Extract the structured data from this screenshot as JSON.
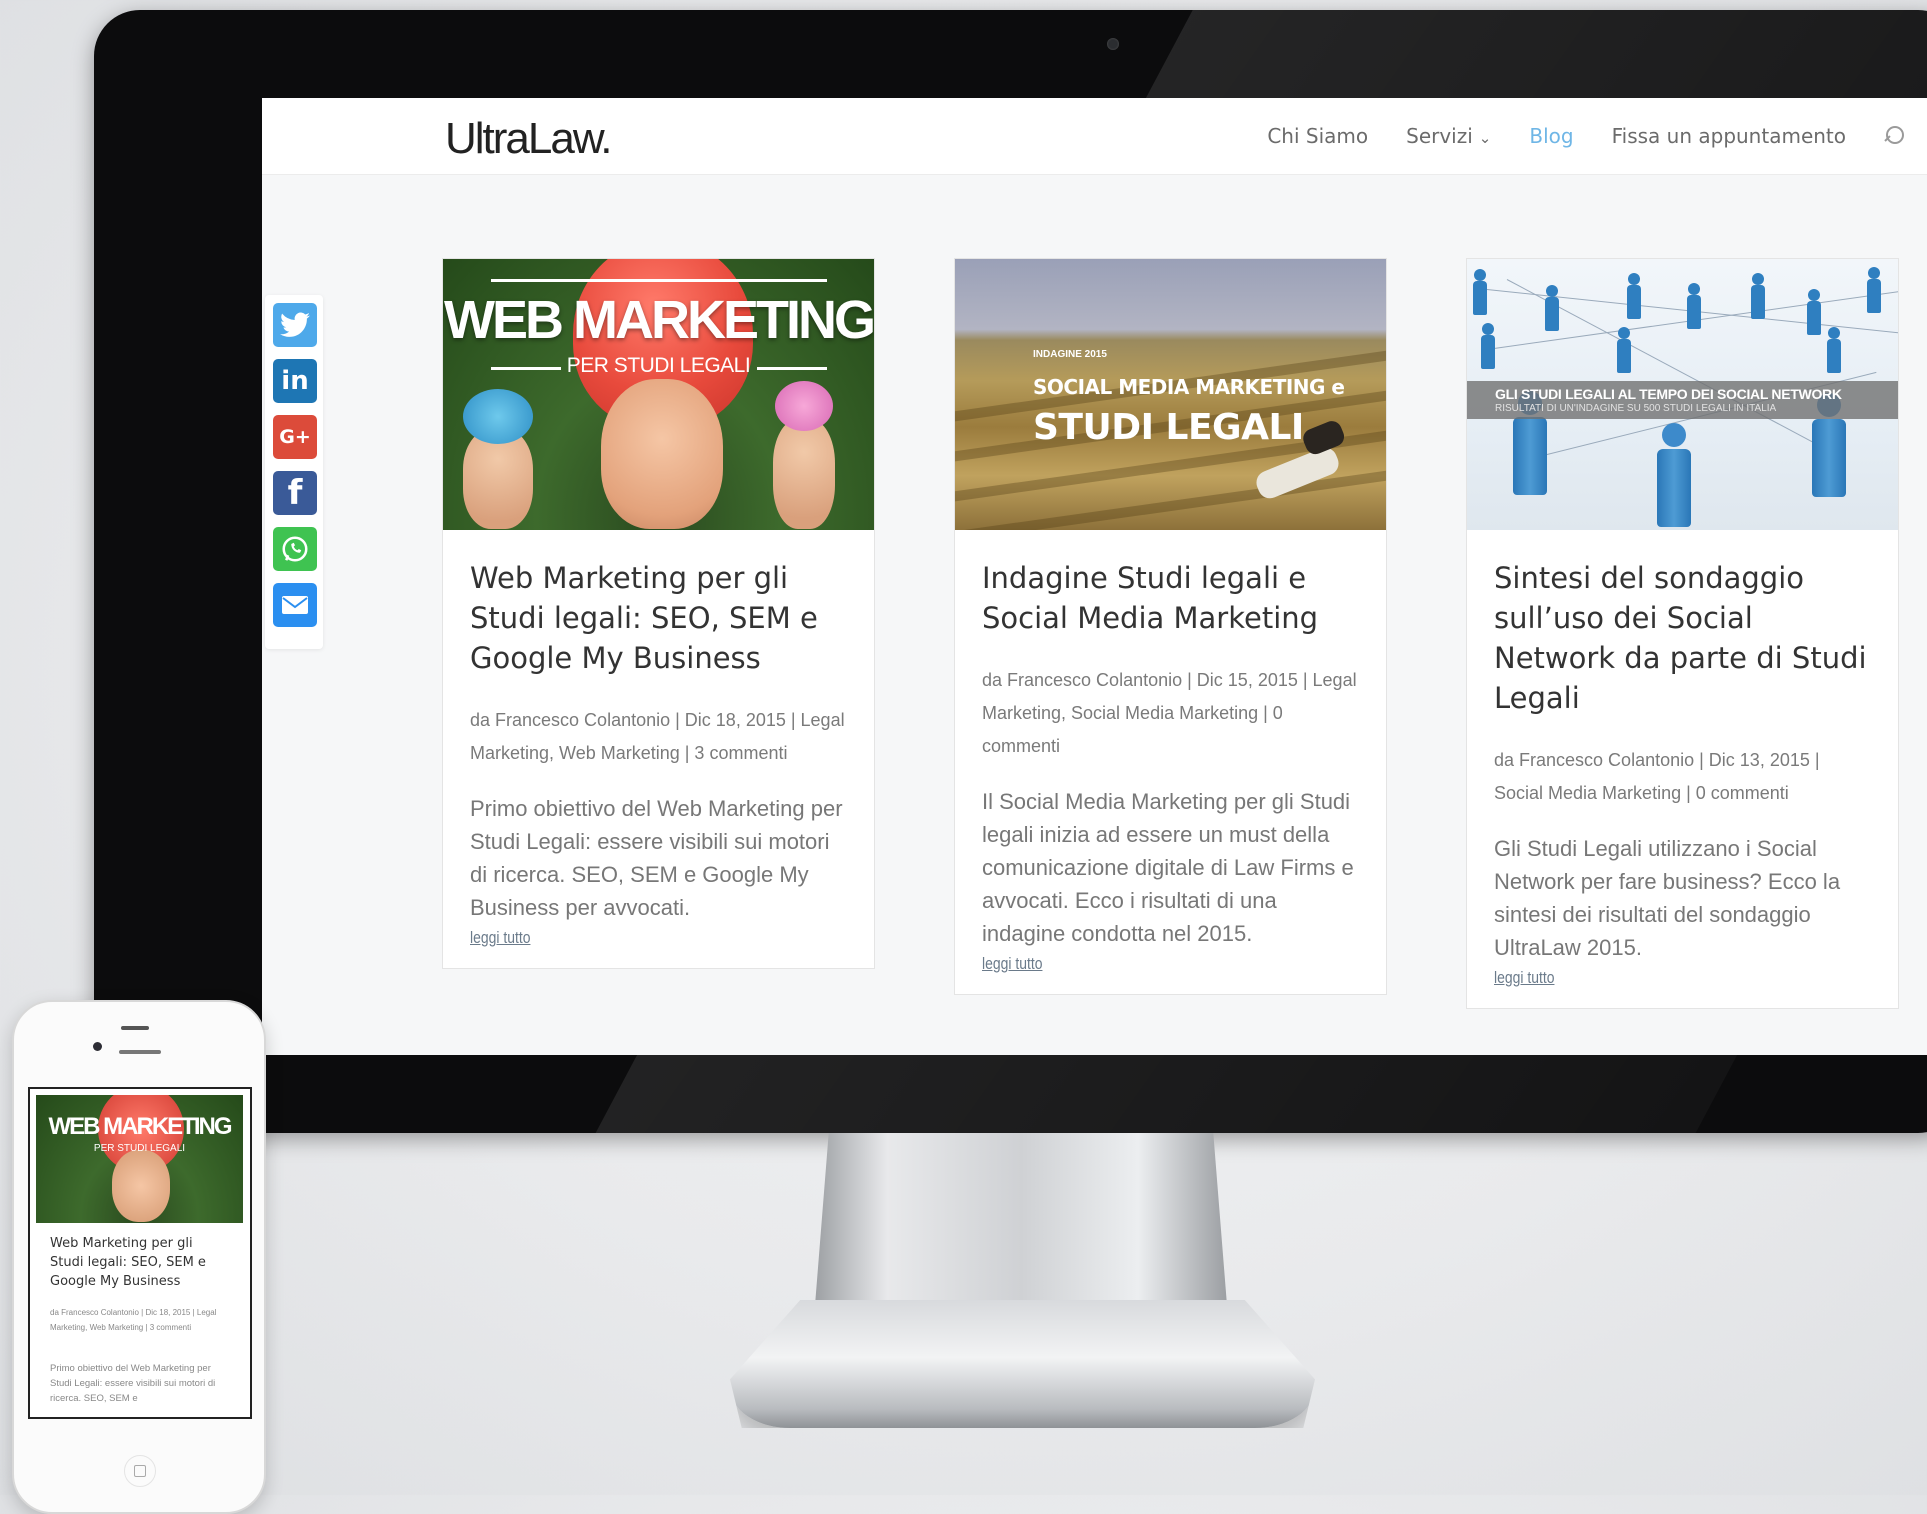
{
  "site": {
    "logo": "UltraLaw."
  },
  "nav": {
    "items": [
      {
        "label": "Chi Siamo"
      },
      {
        "label": "Servizi"
      },
      {
        "label": "Blog"
      },
      {
        "label": "Fissa un appuntamento"
      }
    ],
    "active": "Blog"
  },
  "share": {
    "twitter": "twitter-icon",
    "linkedin_label": "in",
    "googleplus_label": "G+",
    "facebook_label": "f",
    "whatsapp": "whatsapp-icon",
    "email": "email-icon"
  },
  "posts": [
    {
      "image_title": "WEB MARKETING",
      "image_subtitle": "PER STUDI LEGALI",
      "title": "Web Marketing per gli Studi legali: SEO, SEM e Google My Business",
      "meta": "da Francesco Colantonio | Dic 18, 2015 | Legal Marketing, Web Marketing | 3 commenti",
      "excerpt": "Primo obiettivo del Web Marketing per Studi Legali: essere visibili sui motori di ricerca. SEO, SEM e Google My Business per avvocati.",
      "more": "leggi tutto"
    },
    {
      "image_small": "INDAGINE 2015",
      "image_line1": "SOCIAL MEDIA MARKETING e",
      "image_line2": "STUDI LEGALI",
      "title": "Indagine Studi legali e Social Media Marketing",
      "meta": "da Francesco Colantonio | Dic 15, 2015 | Legal Marketing, Social Media Marketing | 0 commenti",
      "excerpt": "Il Social Media Marketing per gli Studi legali inizia ad essere un must della comunicazione digitale di Law Firms e avvocati. Ecco i risultati di una indagine condotta nel 2015.",
      "more": "leggi tutto"
    },
    {
      "image_line1": "GLI STUDI LEGALI AL TEMPO DEI SOCIAL NETWORK",
      "image_line2": "RISULTATI DI UN'INDAGINE SU 500 STUDI LEGALI IN ITALIA",
      "title": "Sintesi del sondaggio sull’uso dei Social Network da parte di Studi Legali",
      "meta": "da Francesco Colantonio | Dic 13, 2015 | Social Media Marketing | 0 commenti",
      "excerpt": "Gli Studi Legali utilizzano i Social Network per fare business? Ecco la sintesi dei risultati del sondaggio UltraLaw 2015.",
      "more": "leggi tutto"
    }
  ],
  "phone": {
    "image_title": "WEB MARKETING",
    "image_subtitle": "PER STUDI LEGALI",
    "title": "Web Marketing per gli Studi legali: SEO, SEM e Google My Business",
    "meta": "da Francesco Colantonio | Dic 18, 2015 | Legal Marketing, Web Marketing | 3 commenti",
    "excerpt": "Primo obiettivo del Web Marketing per Studi Legali: essere visibili sui motori di ricerca. SEO, SEM e"
  },
  "colors": {
    "accent": "#6fb6e6",
    "twitter": "#4ea9ea",
    "linkedin": "#1e76b4",
    "googleplus": "#dc4b3a",
    "facebook": "#3a5a98",
    "whatsapp": "#3fc351",
    "email": "#2b8ff0"
  }
}
